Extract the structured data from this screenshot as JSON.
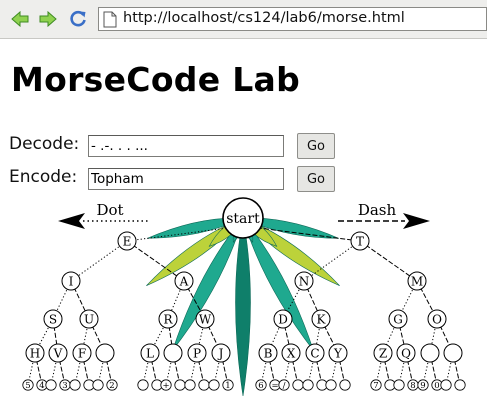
{
  "browser": {
    "url": "http://localhost/cs124/lab6/morse.html",
    "back_icon": "back-arrow-icon",
    "forward_icon": "forward-arrow-icon",
    "reload_icon": "reload-icon",
    "page_icon": "document-icon",
    "icon_color": "#3d8b22"
  },
  "page": {
    "title": "MorseCode Lab"
  },
  "decode": {
    "label": "Decode:",
    "value": "- .-. . . ...",
    "button": "Go"
  },
  "encode": {
    "label": "Encode:",
    "value": "Topham",
    "button": "Go"
  },
  "tree": {
    "start_label": "start",
    "dot_label": "Dot",
    "dash_label": "Dash",
    "leaf_colors": [
      "#1fa98f",
      "#bcd23a",
      "#0f7f6a"
    ],
    "nodes": [
      "E",
      "T",
      "I",
      "A",
      "N",
      "M",
      "S",
      "U",
      "R",
      "W",
      "D",
      "K",
      "G",
      "O",
      "H",
      "V",
      "F",
      "",
      "L",
      "",
      "P",
      "J",
      "B",
      "X",
      "C",
      "Y",
      "Z",
      "Q",
      "",
      ""
    ],
    "bottom_row": [
      "5",
      "4",
      "",
      "3",
      "",
      "",
      "",
      "2",
      "",
      "",
      "+",
      "",
      "",
      "",
      "",
      "1",
      "6",
      "=",
      "/",
      "",
      "",
      "",
      "",
      "",
      "7",
      "",
      "",
      "8",
      "9",
      "0"
    ]
  }
}
